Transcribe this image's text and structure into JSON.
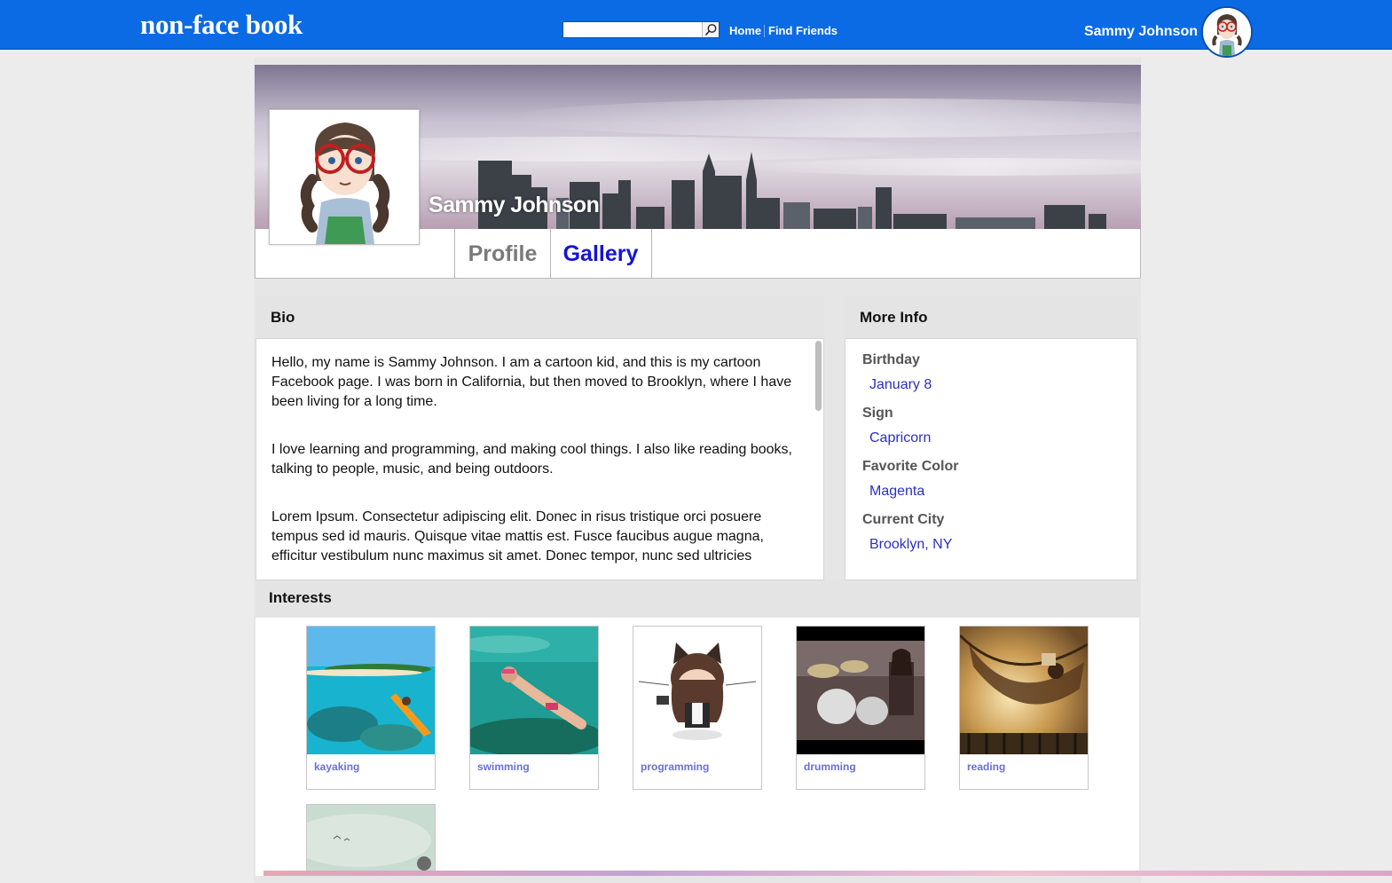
{
  "app": {
    "logo": "non-face book"
  },
  "topnav": {
    "search_placeholder": "",
    "home": "Home",
    "find_friends": "Find Friends",
    "user_name": "Sammy Johnson"
  },
  "profile": {
    "name": "Sammy Johnson",
    "tabs": [
      {
        "label": "Profile",
        "active": false
      },
      {
        "label": "Gallery",
        "active": true
      }
    ]
  },
  "bio": {
    "heading": "Bio",
    "paragraphs": [
      "Hello, my name is Sammy Johnson. I am a cartoon kid, and this is my cartoon Facebook page. I was born in California, but then moved to Brooklyn, where I have been living for a long time.",
      "I love learning and programming, and making cool things. I also like reading books, talking to people, music, and being outdoors.",
      "Lorem Ipsum. Consectetur adipiscing elit. Donec in risus tristique orci posuere tempus sed id mauris. Quisque vitae mattis est. Fusce faucibus augue magna, efficitur vestibulum nunc maximus sit amet. Donec tempor, nunc sed ultricies"
    ]
  },
  "more_info": {
    "heading": "More Info",
    "fields": [
      {
        "label": "Birthday",
        "value": "January 8"
      },
      {
        "label": "Sign",
        "value": "Capricorn"
      },
      {
        "label": "Favorite Color",
        "value": "Magenta"
      },
      {
        "label": "Current City",
        "value": "Brooklyn, NY"
      }
    ]
  },
  "interests": {
    "heading": "Interests",
    "items": [
      {
        "caption": "kayaking"
      },
      {
        "caption": "swimming"
      },
      {
        "caption": "programming"
      },
      {
        "caption": "drumming"
      },
      {
        "caption": "reading"
      },
      {
        "caption": ""
      }
    ]
  },
  "colors": {
    "topbar": "#0a6be4",
    "active_tab": "#1414d4",
    "inactive_tab": "#7a7a7a",
    "link": "#2a2fc5",
    "caption": "#6a6fd6"
  }
}
